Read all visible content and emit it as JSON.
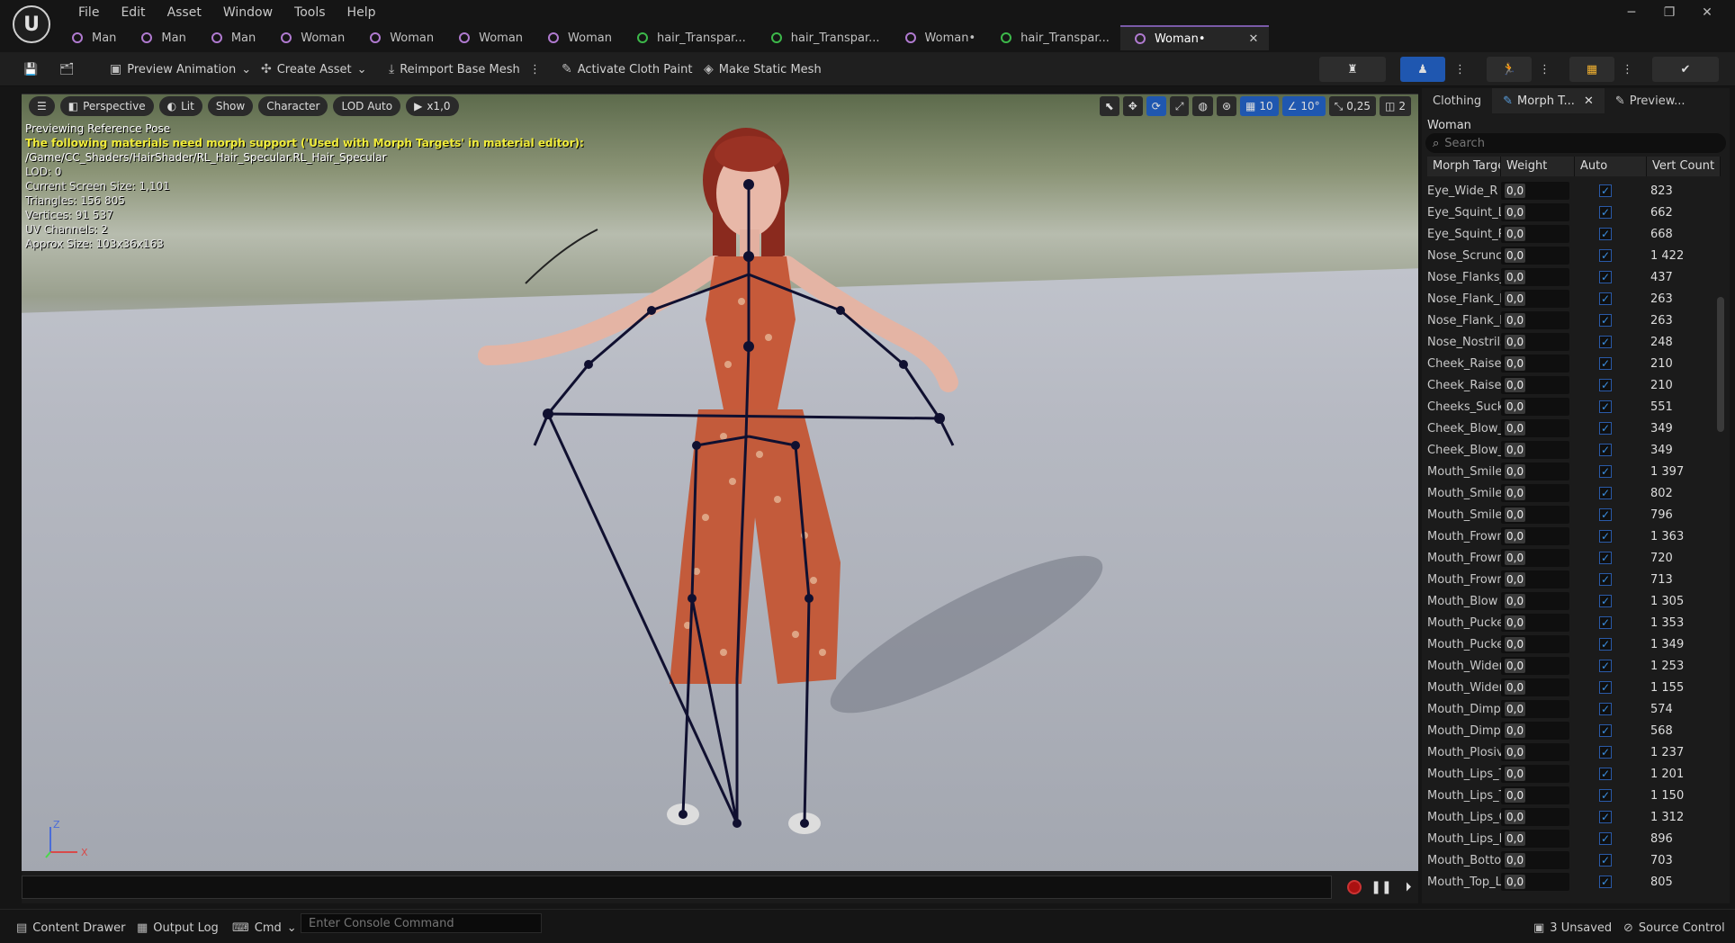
{
  "menu": [
    "File",
    "Edit",
    "Asset",
    "Window",
    "Tools",
    "Help"
  ],
  "tabs": [
    {
      "label": "Man",
      "kind": "char"
    },
    {
      "label": "Man",
      "kind": "char"
    },
    {
      "label": "Man",
      "kind": "char"
    },
    {
      "label": "Woman",
      "kind": "char"
    },
    {
      "label": "Woman",
      "kind": "char"
    },
    {
      "label": "Woman",
      "kind": "char"
    },
    {
      "label": "Woman",
      "kind": "char"
    },
    {
      "label": "hair_Transpar...",
      "kind": "mat"
    },
    {
      "label": "hair_Transpar...",
      "kind": "mat"
    },
    {
      "label": "Woman•",
      "kind": "char"
    },
    {
      "label": "hair_Transpar...",
      "kind": "mat"
    },
    {
      "label": "Woman•",
      "kind": "char",
      "active": true
    }
  ],
  "toolbar": {
    "preview_animation": "Preview Animation",
    "create_asset": "Create Asset",
    "reimport": "Reimport Base Mesh",
    "cloth_paint": "Activate Cloth Paint",
    "static_mesh": "Make Static Mesh"
  },
  "viewport": {
    "perspective": "Perspective",
    "lit": "Lit",
    "show": "Show",
    "character": "Character",
    "lod": "LOD Auto",
    "play_rate": "x1,0",
    "grid_snap": "10",
    "angle_snap": "10°",
    "scale_snap": "0,25",
    "camera_speed": "2",
    "stats": {
      "line1": "Previewing Reference Pose",
      "warning": "The following materials need morph support ('Used with Morph Targets' in material editor):",
      "path": "/Game/CC_Shaders/HairShader/RL_Hair_Specular.RL_Hair_Specular",
      "lod": "LOD: 0",
      "screen_size": "Current Screen Size: 1,101",
      "triangles": "Triangles: 156 805",
      "vertices": "Vertices: 91 537",
      "uv": "UV Channels: 2",
      "approx": "Approx Size: 103x36x163"
    },
    "axis_z": "Z",
    "axis_x": "X"
  },
  "panel": {
    "tabs": [
      "Clothing",
      "Morph T...",
      "Preview..."
    ],
    "label": "Woman",
    "search_placeholder": "Search",
    "columns": [
      "Morph Targe",
      "Weight",
      "Auto",
      "Vert Count"
    ],
    "rows": [
      {
        "name": "Eye_Wide_R",
        "weight": "0,0",
        "count": "823"
      },
      {
        "name": "Eye_Squint_L",
        "weight": "0,0",
        "count": "662"
      },
      {
        "name": "Eye_Squint_R",
        "weight": "0,0",
        "count": "668"
      },
      {
        "name": "Nose_Scrunch",
        "weight": "0,0",
        "count": "1 422"
      },
      {
        "name": "Nose_Flanks_",
        "weight": "0,0",
        "count": "437"
      },
      {
        "name": "Nose_Flank_R",
        "weight": "0,0",
        "count": "263"
      },
      {
        "name": "Nose_Flank_R",
        "weight": "0,0",
        "count": "263"
      },
      {
        "name": "Nose_Nostrils",
        "weight": "0,0",
        "count": "248"
      },
      {
        "name": "Cheek_Raise_",
        "weight": "0,0",
        "count": "210"
      },
      {
        "name": "Cheek_Raise_",
        "weight": "0,0",
        "count": "210"
      },
      {
        "name": "Cheeks_Suck",
        "weight": "0,0",
        "count": "551"
      },
      {
        "name": "Cheek_Blow_L",
        "weight": "0,0",
        "count": "349"
      },
      {
        "name": "Cheek_Blow_R",
        "weight": "0,0",
        "count": "349"
      },
      {
        "name": "Mouth_Smile",
        "weight": "0,0",
        "count": "1 397"
      },
      {
        "name": "Mouth_Smile_",
        "weight": "0,0",
        "count": "802"
      },
      {
        "name": "Mouth_Smile_",
        "weight": "0,0",
        "count": "796"
      },
      {
        "name": "Mouth_Frown",
        "weight": "0,0",
        "count": "1 363"
      },
      {
        "name": "Mouth_Frown_",
        "weight": "0,0",
        "count": "720"
      },
      {
        "name": "Mouth_Frown_",
        "weight": "0,0",
        "count": "713"
      },
      {
        "name": "Mouth_Blow",
        "weight": "0,0",
        "count": "1 305"
      },
      {
        "name": "Mouth_Pucker",
        "weight": "0,0",
        "count": "1 353"
      },
      {
        "name": "Mouth_Pucker",
        "weight": "0,0",
        "count": "1 349"
      },
      {
        "name": "Mouth_Widen",
        "weight": "0,0",
        "count": "1 253"
      },
      {
        "name": "Mouth_Widen_",
        "weight": "0,0",
        "count": "1 155"
      },
      {
        "name": "Mouth_Dimple",
        "weight": "0,0",
        "count": "574"
      },
      {
        "name": "Mouth_Dimple",
        "weight": "0,0",
        "count": "568"
      },
      {
        "name": "Mouth_Plosive",
        "weight": "0,0",
        "count": "1 237"
      },
      {
        "name": "Mouth_Lips_T",
        "weight": "0,0",
        "count": "1 201"
      },
      {
        "name": "Mouth_Lips_T",
        "weight": "0,0",
        "count": "1 150"
      },
      {
        "name": "Mouth_Lips_O",
        "weight": "0,0",
        "count": "1 312"
      },
      {
        "name": "Mouth_Lips_P",
        "weight": "0,0",
        "count": "896"
      },
      {
        "name": "Mouth_Bottom",
        "weight": "0,0",
        "count": "703"
      },
      {
        "name": "Mouth_Top_Li",
        "weight": "0,0",
        "count": "805"
      }
    ]
  },
  "status": {
    "content_drawer": "Content Drawer",
    "output_log": "Output Log",
    "cmd": "Cmd",
    "console_placeholder": "Enter Console Command",
    "unsaved": "3 Unsaved",
    "source_control": "Source Control"
  },
  "colors": {
    "accent_blue": "#1f57b0",
    "tab_purple": "#b07ad0",
    "tab_green": "#3cb84a",
    "warning_yellow": "#f0ec3a"
  }
}
